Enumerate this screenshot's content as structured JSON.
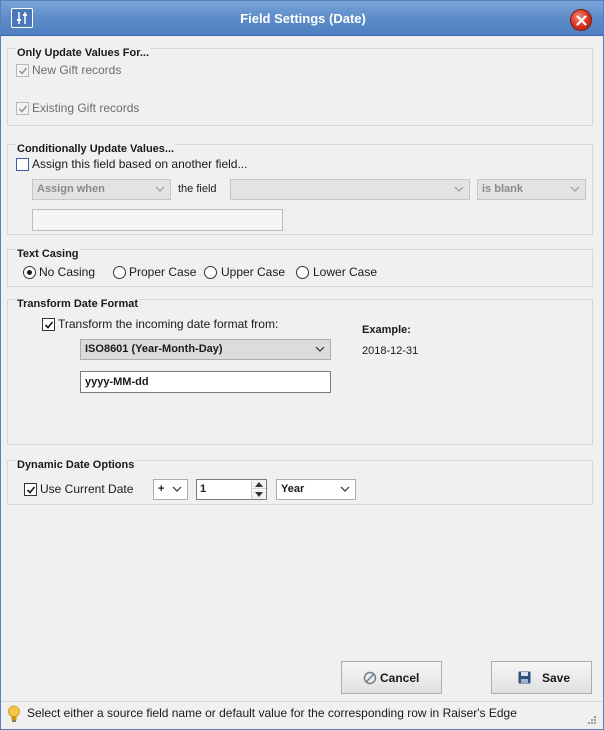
{
  "window": {
    "title": "Field Settings (Date)"
  },
  "only_update": {
    "title": "Only Update Values For...",
    "new_gift_label": "New Gift records",
    "existing_gift_label": "Existing Gift records"
  },
  "conditional": {
    "title": "Conditionally Update Values...",
    "assign_label": "Assign this field based on another field...",
    "assign_when_value": "Assign when",
    "the_field_label": "the field",
    "field_value": "",
    "condition_value": "is blank",
    "default_value": ""
  },
  "text_casing": {
    "title": "Text Casing",
    "options": [
      "No Casing",
      "Proper Case",
      "Upper Case",
      "Lower Case"
    ],
    "selected": "No Casing"
  },
  "transform_date": {
    "title": "Transform Date Format",
    "checkbox_label": "Transform the incoming date format from:",
    "checked": true,
    "format_value": "ISO8601 (Year-Month-Day)",
    "pattern_value": "yyyy-MM-dd",
    "example_label": "Example:",
    "example_value": "2018-12-31"
  },
  "dynamic_date": {
    "title": "Dynamic Date Options",
    "use_current_label": "Use Current Date",
    "checked": true,
    "operator_value": "+",
    "amount_value": "1",
    "unit_value": "Year"
  },
  "buttons": {
    "cancel_label": "Cancel",
    "save_label": "Save"
  },
  "status": {
    "message": "Select either a source field name or default value for the corresponding row in Raiser's Edge"
  },
  "colors": {
    "title_bar": "#5d8cc9",
    "close": "#d6301d",
    "background": "#f0f0f0"
  }
}
